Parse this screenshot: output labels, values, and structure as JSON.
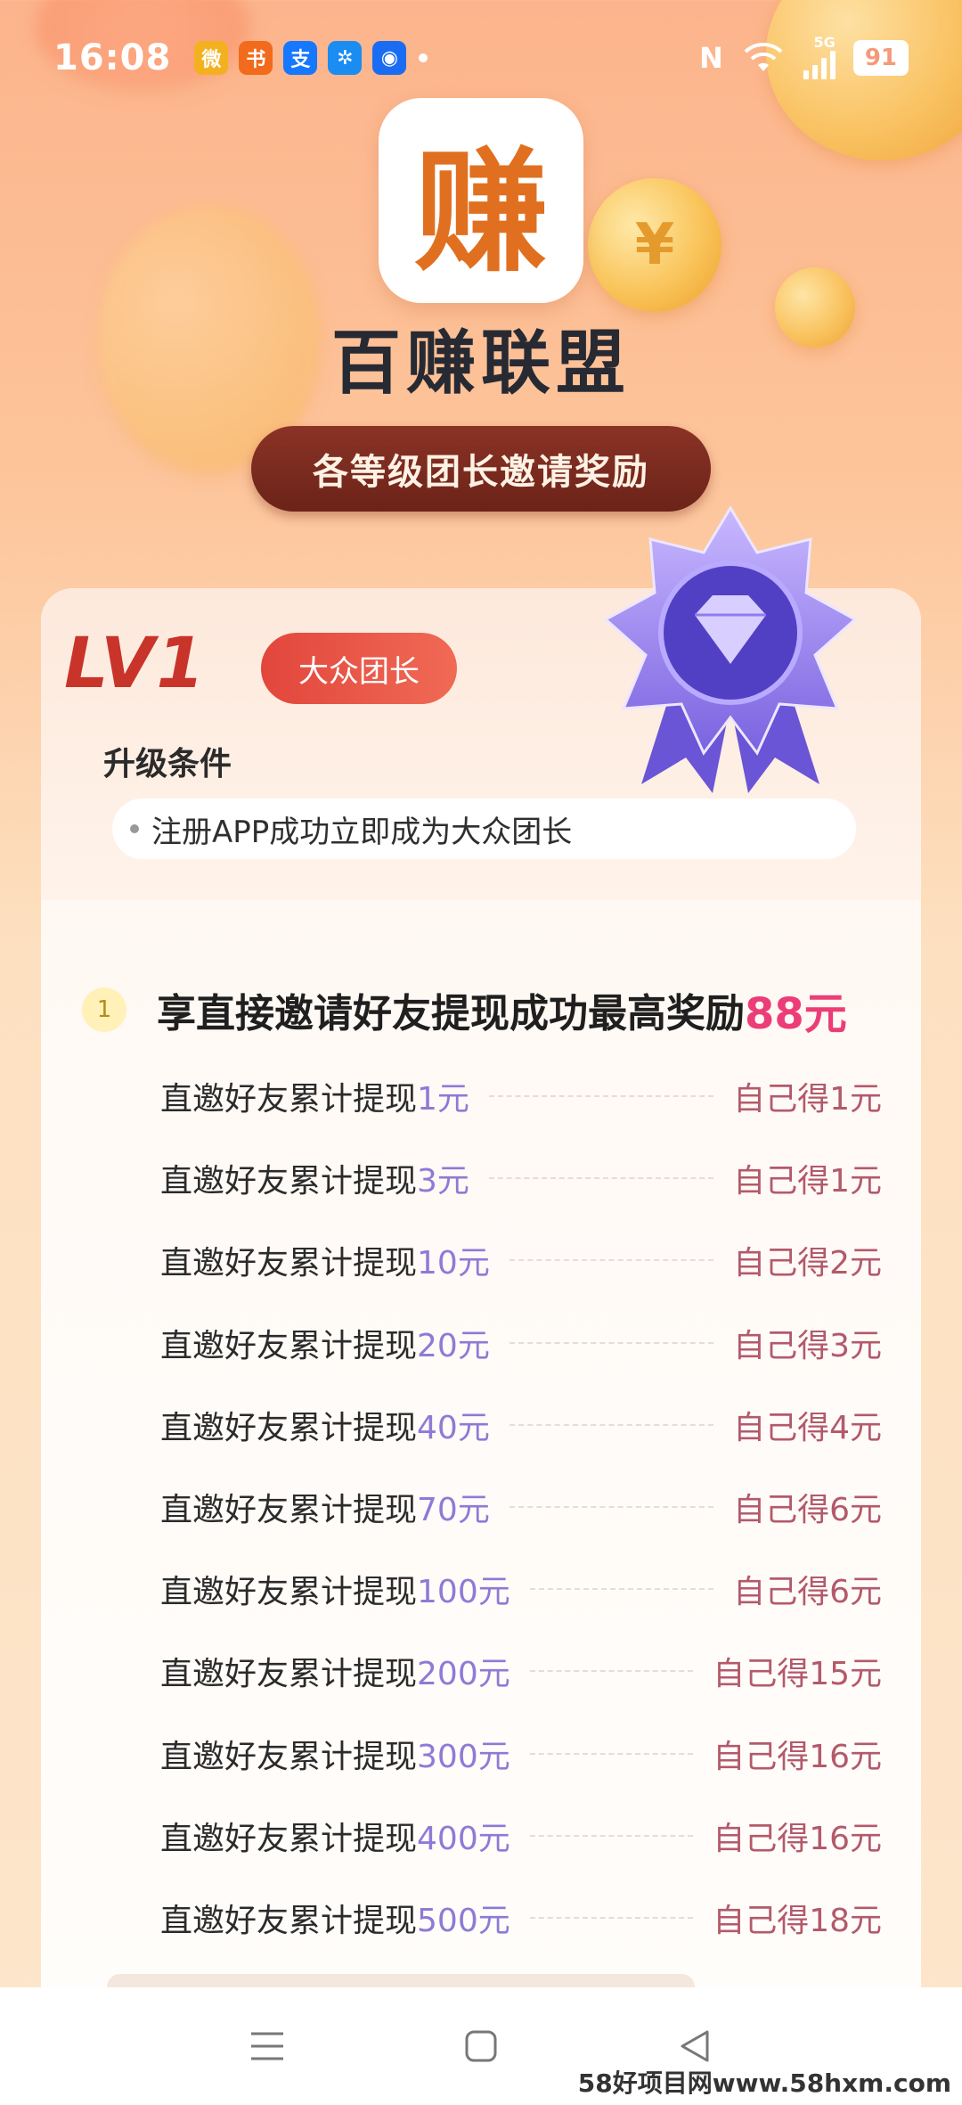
{
  "status_bar": {
    "time": "16:08",
    "notif_icons": [
      {
        "name": "weibo-icon",
        "glyph": "微",
        "color": "#f3b11f"
      },
      {
        "name": "reader-icon",
        "glyph": "书",
        "color": "#f26a1b"
      },
      {
        "name": "alipay-icon",
        "glyph": "支",
        "color": "#1677ff"
      },
      {
        "name": "pinwheel-icon",
        "glyph": "✲",
        "color": "#1b8cf2"
      },
      {
        "name": "circle-app-icon",
        "glyph": "◉",
        "color": "#1a6df2"
      }
    ],
    "network": "5G",
    "battery": "91"
  },
  "app": {
    "logo_glyph": "赚",
    "name": "百赚联盟",
    "banner": "各等级团长邀请奖励"
  },
  "card": {
    "level": "LV1",
    "level_badge": "大众团长",
    "condition_title": "升级条件",
    "condition_text": "注册APP成功立即成为大众团长",
    "section_number": "1",
    "section_text": "享直接邀请好友提现成功最高奖励",
    "section_amount": "88元",
    "rows": [
      {
        "label": "直邀好友累计提现",
        "amount": "1元",
        "reward": "自己得1元"
      },
      {
        "label": "直邀好友累计提现",
        "amount": "3元",
        "reward": "自己得1元"
      },
      {
        "label": "直邀好友累计提现",
        "amount": "10元",
        "reward": "自己得2元"
      },
      {
        "label": "直邀好友累计提现",
        "amount": "20元",
        "reward": "自己得3元"
      },
      {
        "label": "直邀好友累计提现",
        "amount": "40元",
        "reward": "自己得4元"
      },
      {
        "label": "直邀好友累计提现",
        "amount": "70元",
        "reward": "自己得6元"
      },
      {
        "label": "直邀好友累计提现",
        "amount": "100元",
        "reward": "自己得6元"
      },
      {
        "label": "直邀好友累计提现",
        "amount": "200元",
        "reward": "自己得15元"
      },
      {
        "label": "直邀好友累计提现",
        "amount": "300元",
        "reward": "自己得16元"
      },
      {
        "label": "直邀好友累计提现",
        "amount": "400元",
        "reward": "自己得16元"
      },
      {
        "label": "直邀好友累计提现",
        "amount": "500元",
        "reward": "自己得18元"
      }
    ]
  },
  "watermark": "58好项目网www.58hxm.com"
}
